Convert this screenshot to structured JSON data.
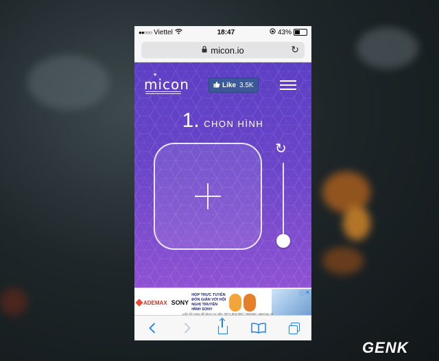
{
  "status_bar": {
    "signal": "●●○○○",
    "carrier": "Viettel",
    "time": "18:47",
    "battery": "43%"
  },
  "browser": {
    "url": "micon.io"
  },
  "app": {
    "logo": "micon",
    "like_label": "Like",
    "like_count": "3.5K",
    "step_number": "1.",
    "step_label": "CHỌN HÌNH"
  },
  "ad": {
    "brand": "ADEMAX",
    "sponsor": "SONY",
    "headline": "HỌP TRỰC TUYẾN ĐÓN GIẢN VỚI HỘI NGHỊ TRUYỀN HÌNH SONY",
    "contact": "Liên hệ ngay để được tư vấn: 0971.803.855 | Website: ademax.vn"
  },
  "watermark": {
    "text": "GEN",
    "accent": "K"
  },
  "colors": {
    "app_gradient_top": "#5b3fc4",
    "app_gradient_bottom": "#8e52d3",
    "facebook_blue": "#3b5998",
    "ios_blue": "#1a7ef0"
  }
}
